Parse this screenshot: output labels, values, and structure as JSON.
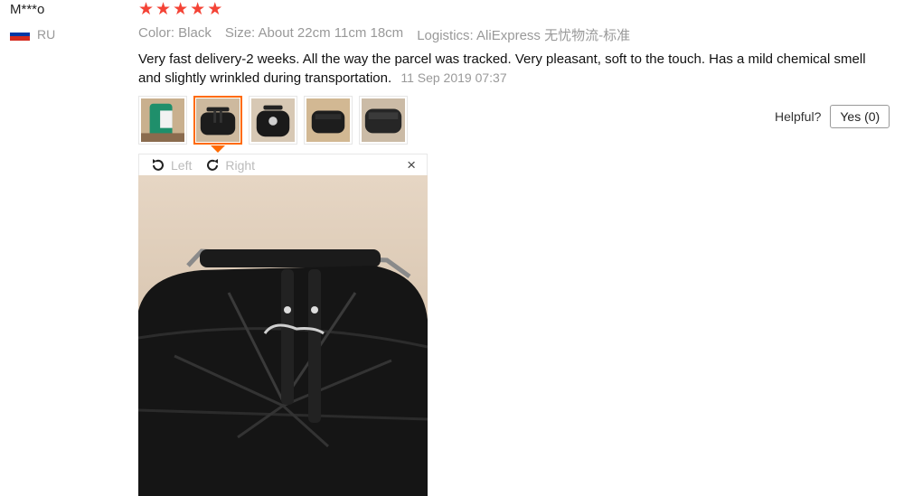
{
  "reviewer": {
    "name": "M***o",
    "country_code": "RU",
    "flag_colors": [
      "#ffffff",
      "#0039a6",
      "#d52b1e"
    ]
  },
  "rating": {
    "stars": 5,
    "max": 5,
    "star_glyph": "★",
    "color": "#f44336"
  },
  "meta": {
    "color": "Color: Black",
    "size": "Size: About 22cm 11cm 18cm",
    "logistics": "Logistics: AliExpress 无忧物流-标准"
  },
  "review": {
    "text": "Very fast delivery-2 weeks. All the way the parcel was tracked. Very pleasant, soft to the touch. Has a mild chemical smell and slightly wrinkled during transportation.",
    "date": "11 Sep 2019 07:37"
  },
  "thumbnails": {
    "count": 5,
    "selected_index": 1,
    "accent": "#ff6a00"
  },
  "viewer": {
    "left_label": "Left",
    "right_label": "Right",
    "close_icon": "×"
  },
  "helpful": {
    "label": "Helpful?",
    "button_label": "Yes (0)"
  }
}
